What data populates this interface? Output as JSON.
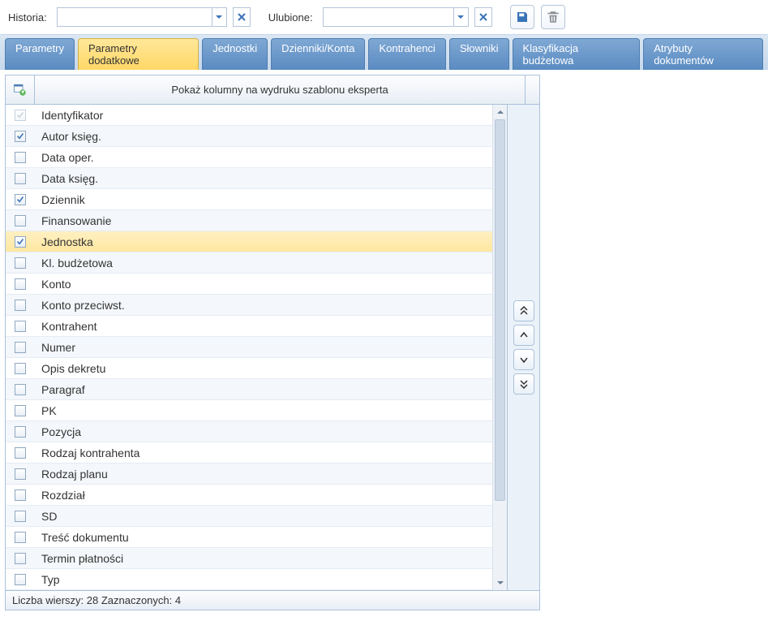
{
  "toolbar": {
    "history_label": "Historia:",
    "favorites_label": "Ulubione:",
    "history_value": "",
    "favorites_value": ""
  },
  "tabs": [
    {
      "label": "Parametry",
      "active": false
    },
    {
      "label": "Parametry dodatkowe",
      "active": true
    },
    {
      "label": "Jednostki",
      "active": false
    },
    {
      "label": "Dzienniki/Konta",
      "active": false
    },
    {
      "label": "Kontrahenci",
      "active": false
    },
    {
      "label": "Słowniki",
      "active": false
    },
    {
      "label": "Klasyfikacja budżetowa",
      "active": false
    },
    {
      "label": "Atrybuty dokumentów",
      "active": false
    }
  ],
  "grid": {
    "header": "Pokaż kolumny na wydruku szablonu eksperta",
    "rows": [
      {
        "label": "Identyfikator",
        "checked": true,
        "disabled": true,
        "selected": false
      },
      {
        "label": "Autor księg.",
        "checked": true,
        "disabled": false,
        "selected": false
      },
      {
        "label": "Data oper.",
        "checked": false,
        "disabled": false,
        "selected": false
      },
      {
        "label": "Data księg.",
        "checked": false,
        "disabled": false,
        "selected": false
      },
      {
        "label": "Dziennik",
        "checked": true,
        "disabled": false,
        "selected": false
      },
      {
        "label": "Finansowanie",
        "checked": false,
        "disabled": false,
        "selected": false
      },
      {
        "label": "Jednostka",
        "checked": true,
        "disabled": false,
        "selected": true
      },
      {
        "label": "Kl. budżetowa",
        "checked": false,
        "disabled": false,
        "selected": false
      },
      {
        "label": "Konto",
        "checked": false,
        "disabled": false,
        "selected": false
      },
      {
        "label": "Konto przeciwst.",
        "checked": false,
        "disabled": false,
        "selected": false
      },
      {
        "label": "Kontrahent",
        "checked": false,
        "disabled": false,
        "selected": false
      },
      {
        "label": "Numer",
        "checked": false,
        "disabled": false,
        "selected": false
      },
      {
        "label": "Opis dekretu",
        "checked": false,
        "disabled": false,
        "selected": false
      },
      {
        "label": "Paragraf",
        "checked": false,
        "disabled": false,
        "selected": false
      },
      {
        "label": "PK",
        "checked": false,
        "disabled": false,
        "selected": false
      },
      {
        "label": "Pozycja",
        "checked": false,
        "disabled": false,
        "selected": false
      },
      {
        "label": "Rodzaj kontrahenta",
        "checked": false,
        "disabled": false,
        "selected": false
      },
      {
        "label": "Rodzaj planu",
        "checked": false,
        "disabled": false,
        "selected": false
      },
      {
        "label": "Rozdział",
        "checked": false,
        "disabled": false,
        "selected": false
      },
      {
        "label": "SD",
        "checked": false,
        "disabled": false,
        "selected": false
      },
      {
        "label": "Treść dokumentu",
        "checked": false,
        "disabled": false,
        "selected": false
      },
      {
        "label": "Termin płatności",
        "checked": false,
        "disabled": false,
        "selected": false
      },
      {
        "label": "Typ",
        "checked": false,
        "disabled": false,
        "selected": false
      }
    ],
    "footer": "Liczba wierszy: 28 Zaznaczonych: 4"
  },
  "icons": {
    "save": "save-icon",
    "trash": "trash-icon",
    "move_top": "move-top-icon",
    "move_up": "move-up-icon",
    "move_down": "move-down-icon",
    "move_bottom": "move-bottom-icon"
  }
}
